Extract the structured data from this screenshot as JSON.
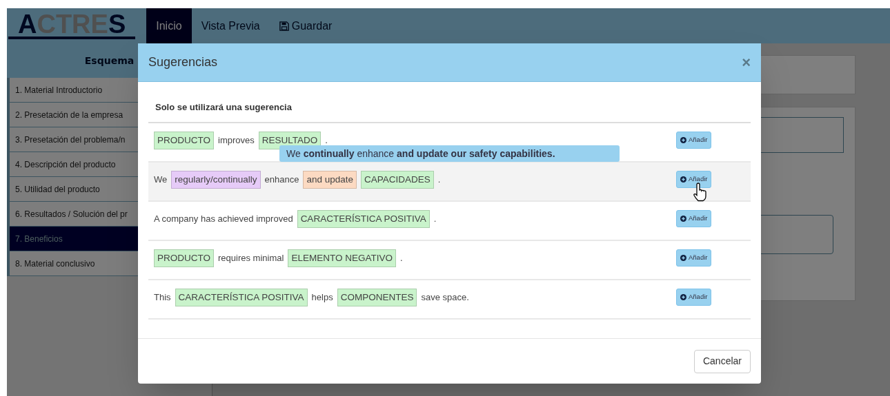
{
  "navbar": {
    "logo": [
      {
        "text": "A",
        "kind": "accent"
      },
      {
        "text": "CTRE",
        "kind": "plain"
      },
      {
        "text": "S",
        "kind": "accent"
      }
    ],
    "items": [
      {
        "label": "Inicio",
        "selected": true,
        "kind": "plain"
      },
      {
        "label": "Vista Previa",
        "selected": false,
        "kind": "plain"
      },
      {
        "label": "Guardar",
        "selected": false,
        "kind": "icon"
      }
    ]
  },
  "sidebar": {
    "title": "Esquema",
    "items": [
      {
        "label": "1. Material Introductorio",
        "selected": false
      },
      {
        "label": "2. Presetación de la empresa",
        "selected": false
      },
      {
        "label": "3. Presetación del problema/n",
        "selected": false
      },
      {
        "label": "4. Descripción del producto",
        "selected": false
      },
      {
        "label": "5. Utilidad del producto",
        "selected": false
      },
      {
        "label": "6. Resultados / Solución del pr",
        "selected": false
      },
      {
        "label": "7. Beneficios",
        "selected": true
      },
      {
        "label": "8. Material conclusivo",
        "selected": false
      }
    ]
  },
  "modal": {
    "title": "Sugerencias",
    "close": "×",
    "note": "Solo se utilizará una sugerencia",
    "suggestions": [
      {
        "highlighted": false,
        "tokens": [
          {
            "kind": "tag",
            "text": "PRODUCTO",
            "color": "#c9f3cb"
          },
          {
            "kind": "text",
            "text": "improves"
          },
          {
            "kind": "tag",
            "text": "RESULTADO",
            "color": "#c9f3cb"
          },
          {
            "kind": "text",
            "text": "."
          }
        ],
        "button": "Añadir",
        "tooltip": "We **continually** enhance **and update our safety capabilities.**"
      },
      {
        "highlighted": true,
        "tokens": [
          {
            "kind": "text",
            "text": "We"
          },
          {
            "kind": "tag",
            "text": "regularly/continually",
            "color": "#e6cbf8"
          },
          {
            "kind": "text",
            "text": "enhance"
          },
          {
            "kind": "tag",
            "text": "and update",
            "color": "#fcdac2"
          },
          {
            "kind": "tag",
            "text": "CAPACIDADES",
            "color": "#c9f3cb"
          },
          {
            "kind": "text",
            "text": "."
          }
        ],
        "button": "Añadir"
      },
      {
        "highlighted": false,
        "tokens": [
          {
            "kind": "text",
            "text": "A company has achieved improved"
          },
          {
            "kind": "tag",
            "text": "CARACTERÍSTICA POSITIVA",
            "color": "#c9f3cb"
          },
          {
            "kind": "text",
            "text": "."
          }
        ],
        "button": "Añadir"
      },
      {
        "highlighted": false,
        "tokens": [
          {
            "kind": "tag",
            "text": "PRODUCTO",
            "color": "#c9f3cb"
          },
          {
            "kind": "text",
            "text": "requires minimal"
          },
          {
            "kind": "tag",
            "text": "ELEMENTO NEGATIVO",
            "color": "#c9f3cb"
          },
          {
            "kind": "text",
            "text": "."
          }
        ],
        "button": "Añadir"
      },
      {
        "highlighted": false,
        "tokens": [
          {
            "kind": "text",
            "text": "This"
          },
          {
            "kind": "tag",
            "text": "CARACTERÍSTICA POSITIVA",
            "color": "#c9f3cb"
          },
          {
            "kind": "text",
            "text": "helps"
          },
          {
            "kind": "tag",
            "text": "COMPONENTES",
            "color": "#c9f3cb"
          },
          {
            "kind": "text",
            "text": "save space."
          }
        ],
        "button": "Añadir"
      }
    ],
    "cancel": "Cancelar"
  }
}
